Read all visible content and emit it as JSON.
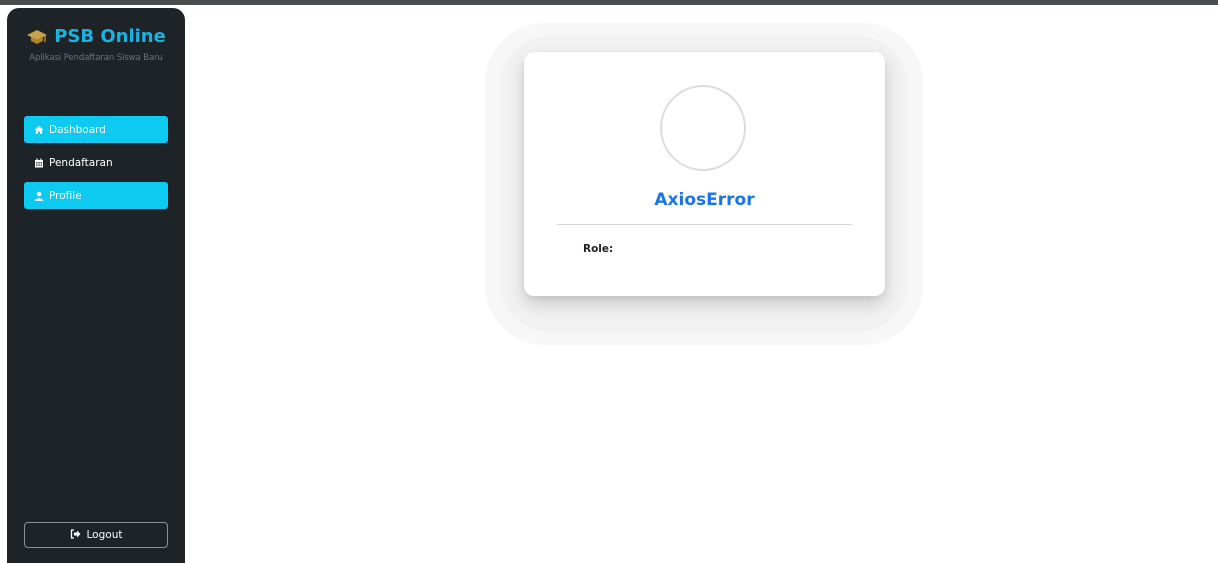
{
  "brand": {
    "title": "PSB Online",
    "subtitle": "Aplikasi Pendaftaran Siswa Baru",
    "icon": "graduation-cap-icon",
    "color": "#19b3e2"
  },
  "sidebar": {
    "items": [
      {
        "label": "Dashboard",
        "icon": "home-icon",
        "active": true
      },
      {
        "label": "Pendaftaran",
        "icon": "calendar-icon",
        "active": false
      },
      {
        "label": "Profile",
        "icon": "user-icon",
        "active": true
      }
    ],
    "logout_label": "Logout",
    "logout_icon": "sign-out-icon",
    "active_color": "#0dcaf0",
    "background": "#1e2327"
  },
  "profile": {
    "name": "AxiosError",
    "role_label": "Role:",
    "role_value": "",
    "name_color": "#1a73e8"
  }
}
